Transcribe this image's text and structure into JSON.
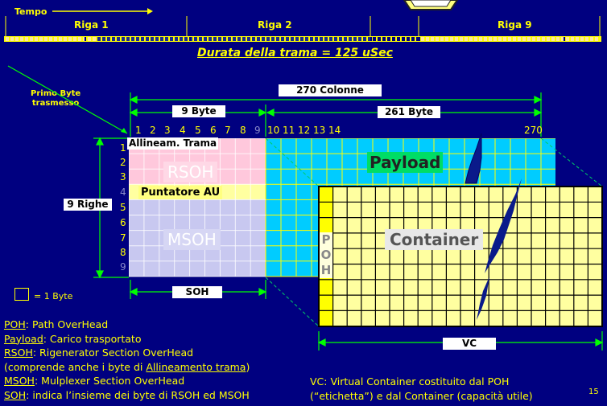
{
  "header": {
    "time_label": "Tempo",
    "rows": [
      "Riga 1",
      "Riga 2",
      "Riga 9"
    ],
    "duration": "Durata della trama = 125 uSec"
  },
  "frame": {
    "first_byte": "Primo Byte\ntrasmesso",
    "cols_total": "270 Colonne",
    "cols_soh": "9 Byte",
    "cols_payload": "261 Byte",
    "rows_label": "9 Righe",
    "col_numbers": [
      "1",
      "2",
      "3",
      "4",
      "5",
      "6",
      "7",
      "8",
      "9",
      "10",
      "11",
      "12",
      "13",
      "14",
      "270"
    ],
    "row_numbers": [
      "1",
      "2",
      "3",
      "4",
      "5",
      "6",
      "7",
      "8",
      "9"
    ],
    "allineam": "Allineam. Trama",
    "rsoh": "RSOH",
    "puntatore": "Puntatore AU",
    "msoh": "MSOH",
    "payload": "Payload",
    "soh": "SOH",
    "byte_legend": "= 1 Byte"
  },
  "vc": {
    "poh": [
      "P",
      "O",
      "H"
    ],
    "container": "Container",
    "label": "VC"
  },
  "legend": {
    "poh_key": "POH",
    "poh_text": ": Path OverHead",
    "payload_key": "Payload",
    "payload_text": ": Carico trasportato",
    "rsoh_key": "RSOH",
    "rsoh_text": ": Rigenerator Section OverHead",
    "rsoh_note_pre": "(comprende anche i byte di ",
    "rsoh_note_key": "Allineamento trama",
    "rsoh_note_post": ")",
    "msoh_key": "MSOH",
    "msoh_text": ": Mulplexer Section OverHead",
    "soh_key": "SOH",
    "soh_text": ": indica l’insieme dei byte di RSOH ed MSOH",
    "vc_line1": "VC: Virtual Container costituito dal POH",
    "vc_line2": "(“etichetta”) e dal Container (capacità utile)"
  },
  "page_number": "15",
  "colors": {
    "background": "#000080",
    "rsoh": "#ffc8dc",
    "msoh": "#c8c8f0",
    "payload": "#00ccff",
    "container": "#ffffa0",
    "grid": "#ffff00"
  }
}
